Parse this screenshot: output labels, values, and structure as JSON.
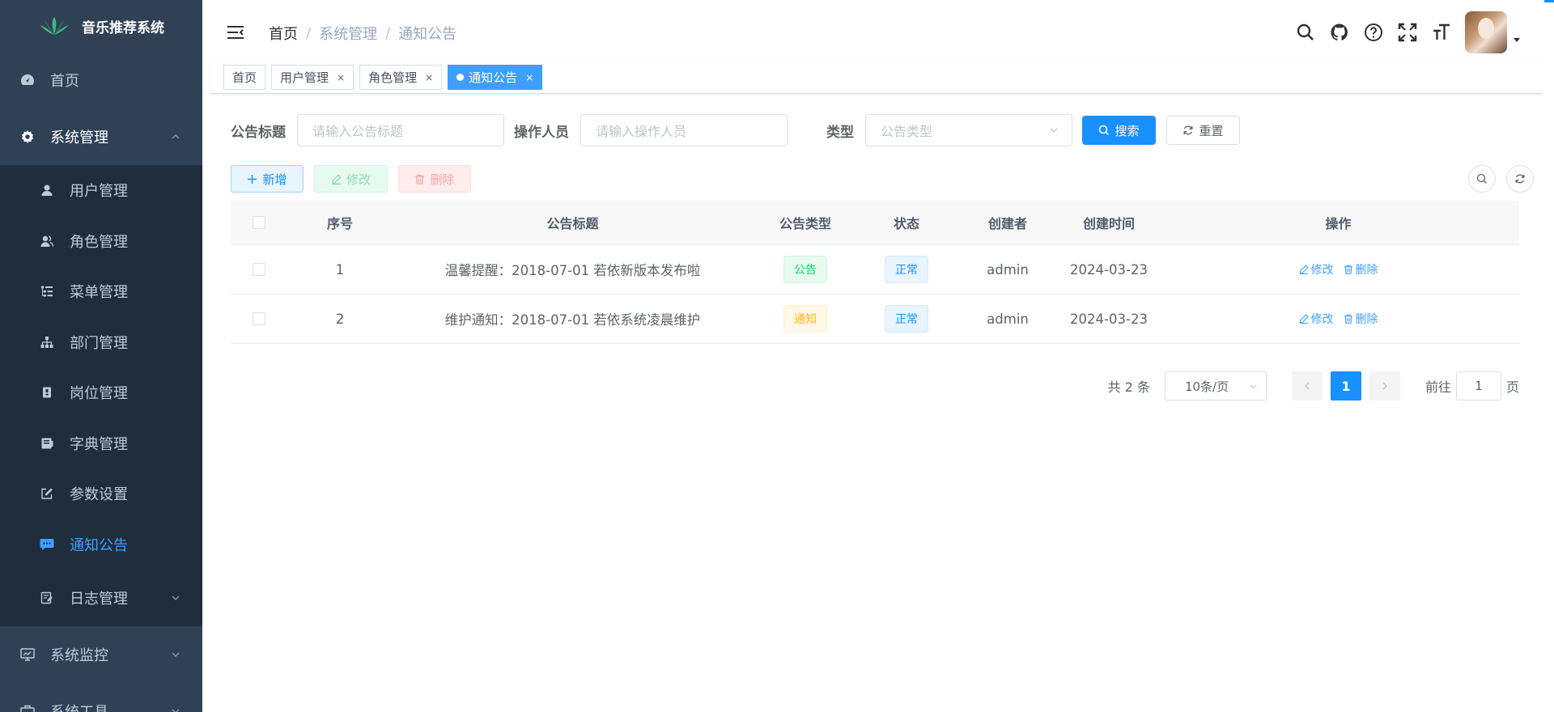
{
  "colors": {
    "sidebar_bg": "#304156",
    "submenu_bg": "#1f2d3d",
    "primary": "#1890ff",
    "active_menu": "#409eff"
  },
  "sidebar": {
    "logo_text": "音乐推荐系统",
    "items": [
      {
        "label": "首页",
        "icon": "dashboard-icon"
      },
      {
        "label": "系统管理",
        "icon": "gear-icon",
        "expanded": true,
        "children": [
          {
            "label": "用户管理",
            "icon": "user-icon"
          },
          {
            "label": "角色管理",
            "icon": "peoples-icon"
          },
          {
            "label": "菜单管理",
            "icon": "tree-table-icon"
          },
          {
            "label": "部门管理",
            "icon": "tree-icon"
          },
          {
            "label": "岗位管理",
            "icon": "post-icon"
          },
          {
            "label": "字典管理",
            "icon": "dict-icon"
          },
          {
            "label": "参数设置",
            "icon": "edit-icon"
          },
          {
            "label": "通知公告",
            "icon": "message-icon",
            "active": true
          },
          {
            "label": "日志管理",
            "icon": "log-icon"
          }
        ]
      },
      {
        "label": "系统监控",
        "icon": "monitor-icon"
      },
      {
        "label": "系统工具",
        "icon": "tool-icon"
      }
    ]
  },
  "breadcrumb": [
    "首页",
    "系统管理",
    "通知公告"
  ],
  "tags": [
    {
      "label": "首页",
      "closable": false
    },
    {
      "label": "用户管理",
      "closable": true
    },
    {
      "label": "角色管理",
      "closable": true
    },
    {
      "label": "通知公告",
      "closable": true,
      "active": true
    }
  ],
  "tag_close": "×",
  "search": {
    "title_label": "公告标题",
    "title_placeholder": "请输入公告标题",
    "operator_label": "操作人员",
    "operator_placeholder": "请输入操作人员",
    "type_label": "类型",
    "type_placeholder": "公告类型",
    "search_btn": "搜索",
    "reset_btn": "重置"
  },
  "toolbar": {
    "add": "新增",
    "edit": "修改",
    "delete": "删除"
  },
  "table": {
    "headers": [
      "序号",
      "公告标题",
      "公告类型",
      "状态",
      "创建者",
      "创建时间",
      "操作"
    ],
    "rows": [
      {
        "no": "1",
        "title": "温馨提醒：2018-07-01 若依新版本发布啦",
        "type": "公告",
        "type_style": "success",
        "status": "正常",
        "creator": "admin",
        "time": "2024-03-23"
      },
      {
        "no": "2",
        "title": "维护通知：2018-07-01 若依系统凌晨维护",
        "type": "通知",
        "type_style": "warning",
        "status": "正常",
        "creator": "admin",
        "time": "2024-03-23"
      }
    ],
    "op_edit": "修改",
    "op_delete": "删除"
  },
  "pagination": {
    "total": "共 2 条",
    "page_size": "10条/页",
    "current": "1",
    "goto_prefix": "前往",
    "goto_value": "1",
    "goto_suffix": "页"
  }
}
